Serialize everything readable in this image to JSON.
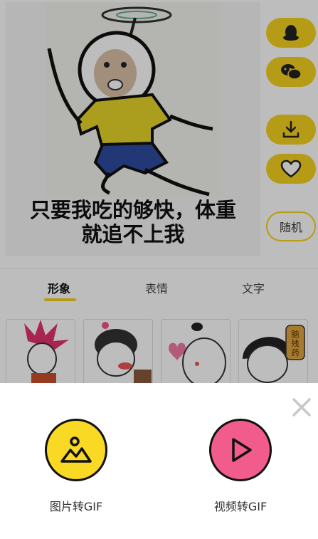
{
  "meme": {
    "caption_line1": "只要我吃的够快，体重",
    "caption_line2": "就追不上我"
  },
  "side_actions": {
    "qq_icon": "qq-icon",
    "wechat_icon": "wechat-icon",
    "download_icon": "download-icon",
    "favorite_icon": "heart-icon",
    "random_label": "随机"
  },
  "tabs": [
    {
      "label": "形象",
      "active": true
    },
    {
      "label": "表情",
      "active": false
    },
    {
      "label": "文字",
      "active": false
    }
  ],
  "thumbnails": {
    "item4_label_line1": "脑",
    "item4_label_line2": "残",
    "item4_label_line3": "药"
  },
  "sheet": {
    "options": [
      {
        "label": "图片转GIF",
        "icon": "image-icon",
        "color": "#f9d923"
      },
      {
        "label": "视频转GIF",
        "icon": "play-icon",
        "color": "#f25c8c"
      }
    ]
  },
  "colors": {
    "accent": "#f6d21e",
    "pink": "#f25c8c"
  }
}
